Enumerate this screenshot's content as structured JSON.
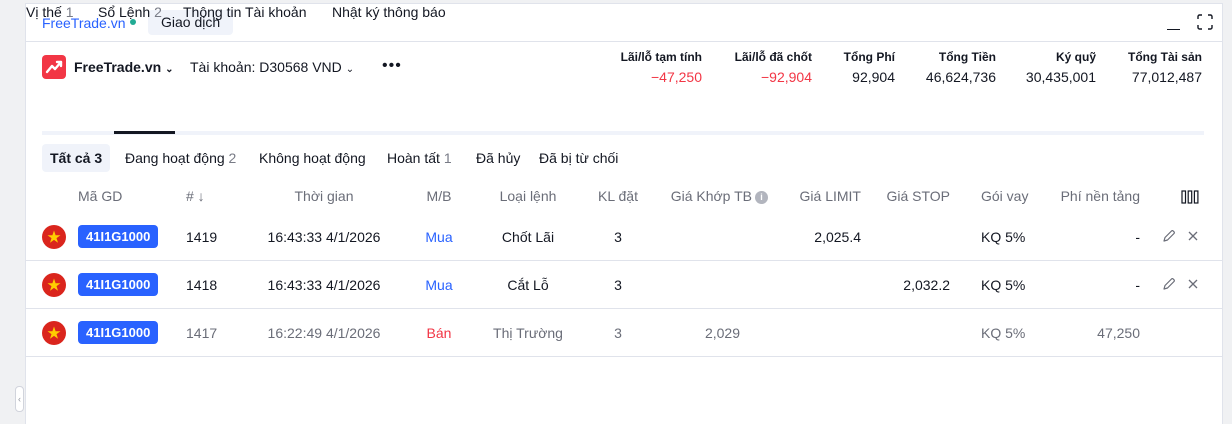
{
  "window": {
    "brand_link": "FreeTrade.vn",
    "tab": "Giao dịch"
  },
  "account_bar": {
    "brand_name": "FreeTrade.vn",
    "account": "Tài khoản: D30568 VND",
    "more": "•••",
    "metrics": [
      {
        "label": "Lãi/lỗ tạm tính",
        "value": "−47,250",
        "negative": true
      },
      {
        "label": "Lãi/lỗ đã chốt",
        "value": "−92,904",
        "negative": true
      },
      {
        "label": "Tổng Phí",
        "value": "92,904",
        "negative": false
      },
      {
        "label": "Tổng Tiền",
        "value": "46,624,736",
        "negative": false
      },
      {
        "label": "Ký quỹ",
        "value": "30,435,001",
        "negative": false
      },
      {
        "label": "Tổng Tài sản",
        "value": "77,012,487",
        "negative": false
      }
    ]
  },
  "main_tabs": [
    {
      "label": "Vị thế",
      "count": "1"
    },
    {
      "label": "Sổ Lệnh",
      "count": "2"
    },
    {
      "label": "Thông tin Tài khoản",
      "count": ""
    },
    {
      "label": "Nhật ký thông báo",
      "count": ""
    }
  ],
  "active_main_tab": "Sổ Lệnh",
  "filters": [
    {
      "label": "Tất cả",
      "count": "3"
    },
    {
      "label": "Đang hoạt động",
      "count": "2"
    },
    {
      "label": "Không hoạt động",
      "count": ""
    },
    {
      "label": "Hoàn tất",
      "count": "1"
    },
    {
      "label": "Đã hủy",
      "count": ""
    },
    {
      "label": "Đã bị từ chối",
      "count": ""
    }
  ],
  "active_filter": "Tất cả",
  "table": {
    "headers": {
      "symbol": "Mã GD",
      "id": "# ↓",
      "time": "Thời gian",
      "side": "M/B",
      "type": "Loại lệnh",
      "qty": "KL đặt",
      "avg_price": "Giá Khớp TB",
      "limit": "Giá LIMIT",
      "stop": "Giá STOP",
      "loan": "Gói vay",
      "fee": "Phí nền tảng"
    },
    "rows": [
      {
        "symbol": "41I1G1000",
        "id": "1419",
        "time": "16:43:33 4/1/2026",
        "side": "Mua",
        "side_kind": "buy",
        "type": "Chốt Lãi",
        "qty": "3",
        "avg_price": "",
        "limit": "2,025.4",
        "stop": "",
        "loan": "KQ 5%",
        "fee": "-",
        "muted": false,
        "editable": true
      },
      {
        "symbol": "41I1G1000",
        "id": "1418",
        "time": "16:43:33 4/1/2026",
        "side": "Mua",
        "side_kind": "buy",
        "type": "Cắt Lỗ",
        "qty": "3",
        "avg_price": "",
        "limit": "",
        "stop": "2,032.2",
        "loan": "KQ 5%",
        "fee": "-",
        "muted": false,
        "editable": true
      },
      {
        "symbol": "41I1G1000",
        "id": "1417",
        "time": "16:22:49 4/1/2026",
        "side": "Bán",
        "side_kind": "sell",
        "type": "Thị Trường",
        "qty": "3",
        "avg_price": "2,029",
        "limit": "",
        "stop": "",
        "loan": "KQ 5%",
        "fee": "47,250",
        "muted": true,
        "editable": false
      }
    ]
  },
  "colors": {
    "accent": "#2962ff",
    "negative": "#f23645",
    "flag_red": "#da251d",
    "flag_star": "#ffcd00"
  }
}
